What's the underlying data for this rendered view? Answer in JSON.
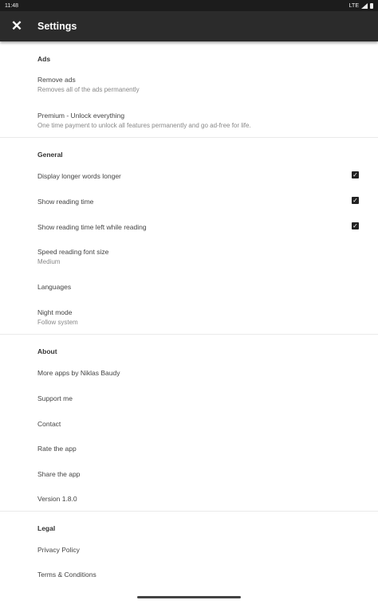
{
  "status": {
    "time": "11:48",
    "network": "LTE"
  },
  "appbar": {
    "title": "Settings",
    "close_icon": "close-icon"
  },
  "sections": {
    "ads": {
      "header": "Ads",
      "remove_ads": {
        "title": "Remove ads",
        "summary": "Removes all of the ads permanently"
      },
      "premium": {
        "title": "Premium - Unlock everything",
        "summary": "One time payment to unlock all features permanently and go ad-free for life."
      }
    },
    "general": {
      "header": "General",
      "display_longer": {
        "title": "Display longer words longer",
        "checked": true
      },
      "show_reading_time": {
        "title": "Show reading time",
        "checked": true
      },
      "show_reading_time_left": {
        "title": "Show reading time left while reading",
        "checked": true
      },
      "font_size": {
        "title": "Speed reading font size",
        "summary": "Medium"
      },
      "languages": {
        "title": "Languages"
      },
      "night_mode": {
        "title": "Night mode",
        "summary": "Follow system"
      }
    },
    "about": {
      "header": "About",
      "more_apps": {
        "title": "More apps by Niklas Baudy"
      },
      "support": {
        "title": "Support me"
      },
      "contact": {
        "title": "Contact"
      },
      "rate": {
        "title": "Rate the app"
      },
      "share": {
        "title": "Share the app"
      },
      "version": {
        "title": "Version 1.8.0"
      }
    },
    "legal": {
      "header": "Legal",
      "privacy": {
        "title": "Privacy Policy"
      },
      "terms": {
        "title": "Terms & Conditions"
      }
    }
  },
  "colors": {
    "appbar": "#2b2b2b",
    "statusbar": "#1c1c1c",
    "checkbox": "#222222"
  }
}
